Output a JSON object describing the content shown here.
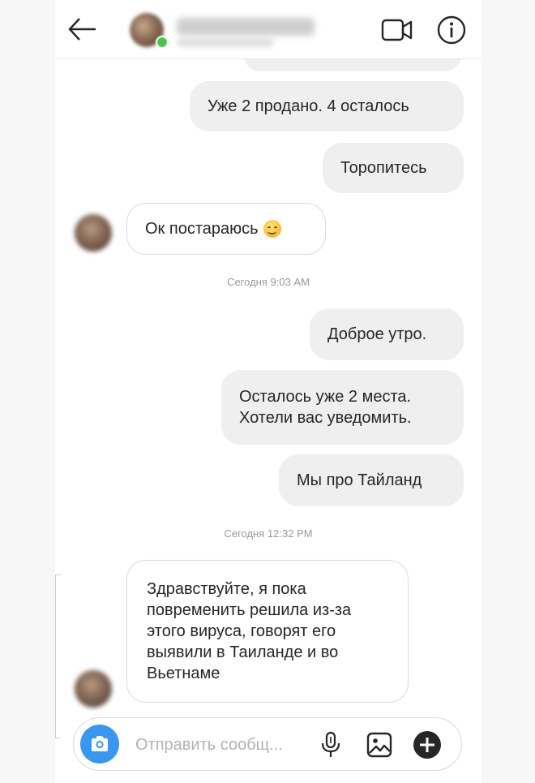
{
  "header": {
    "contact_name": "",
    "video_call_icon": "video-camera-icon",
    "info_icon": "info-icon",
    "back_icon": "arrow-left-icon"
  },
  "messages": [
    {
      "direction": "out",
      "text": "Уже 2 продано. 4 осталось"
    },
    {
      "direction": "out",
      "text": "Торопитесь"
    },
    {
      "direction": "in",
      "text": "Ок постараюсь",
      "emoji": "smiling-face-icon"
    },
    {
      "direction": "out",
      "text": "Доброе утро."
    },
    {
      "direction": "out",
      "lines": [
        "Осталось уже 2 места.",
        "Хотели вас уведомить."
      ]
    },
    {
      "direction": "out",
      "text": "Мы про Тайланд"
    },
    {
      "direction": "in",
      "lines": [
        "Здравствуйте, я пока",
        "повременить решила из-за",
        "этого вируса, говорят его",
        "выявили в Таиланде и во",
        "Вьетнаме"
      ]
    }
  ],
  "timestamps": [
    "Сегодня 9:03 AM",
    "Сегодня 12:32 PM"
  ],
  "composer": {
    "placeholder": "Отправить сообщ...",
    "camera_icon": "camera-icon",
    "mic_icon": "microphone-icon",
    "gallery_icon": "image-icon",
    "plus_icon": "plus-circle-icon"
  },
  "colors": {
    "accent": "#3897f0",
    "outgoing_bubble": "#efefef",
    "incoming_border": "#dbdbdb",
    "timestamp": "#9a9a9a"
  }
}
